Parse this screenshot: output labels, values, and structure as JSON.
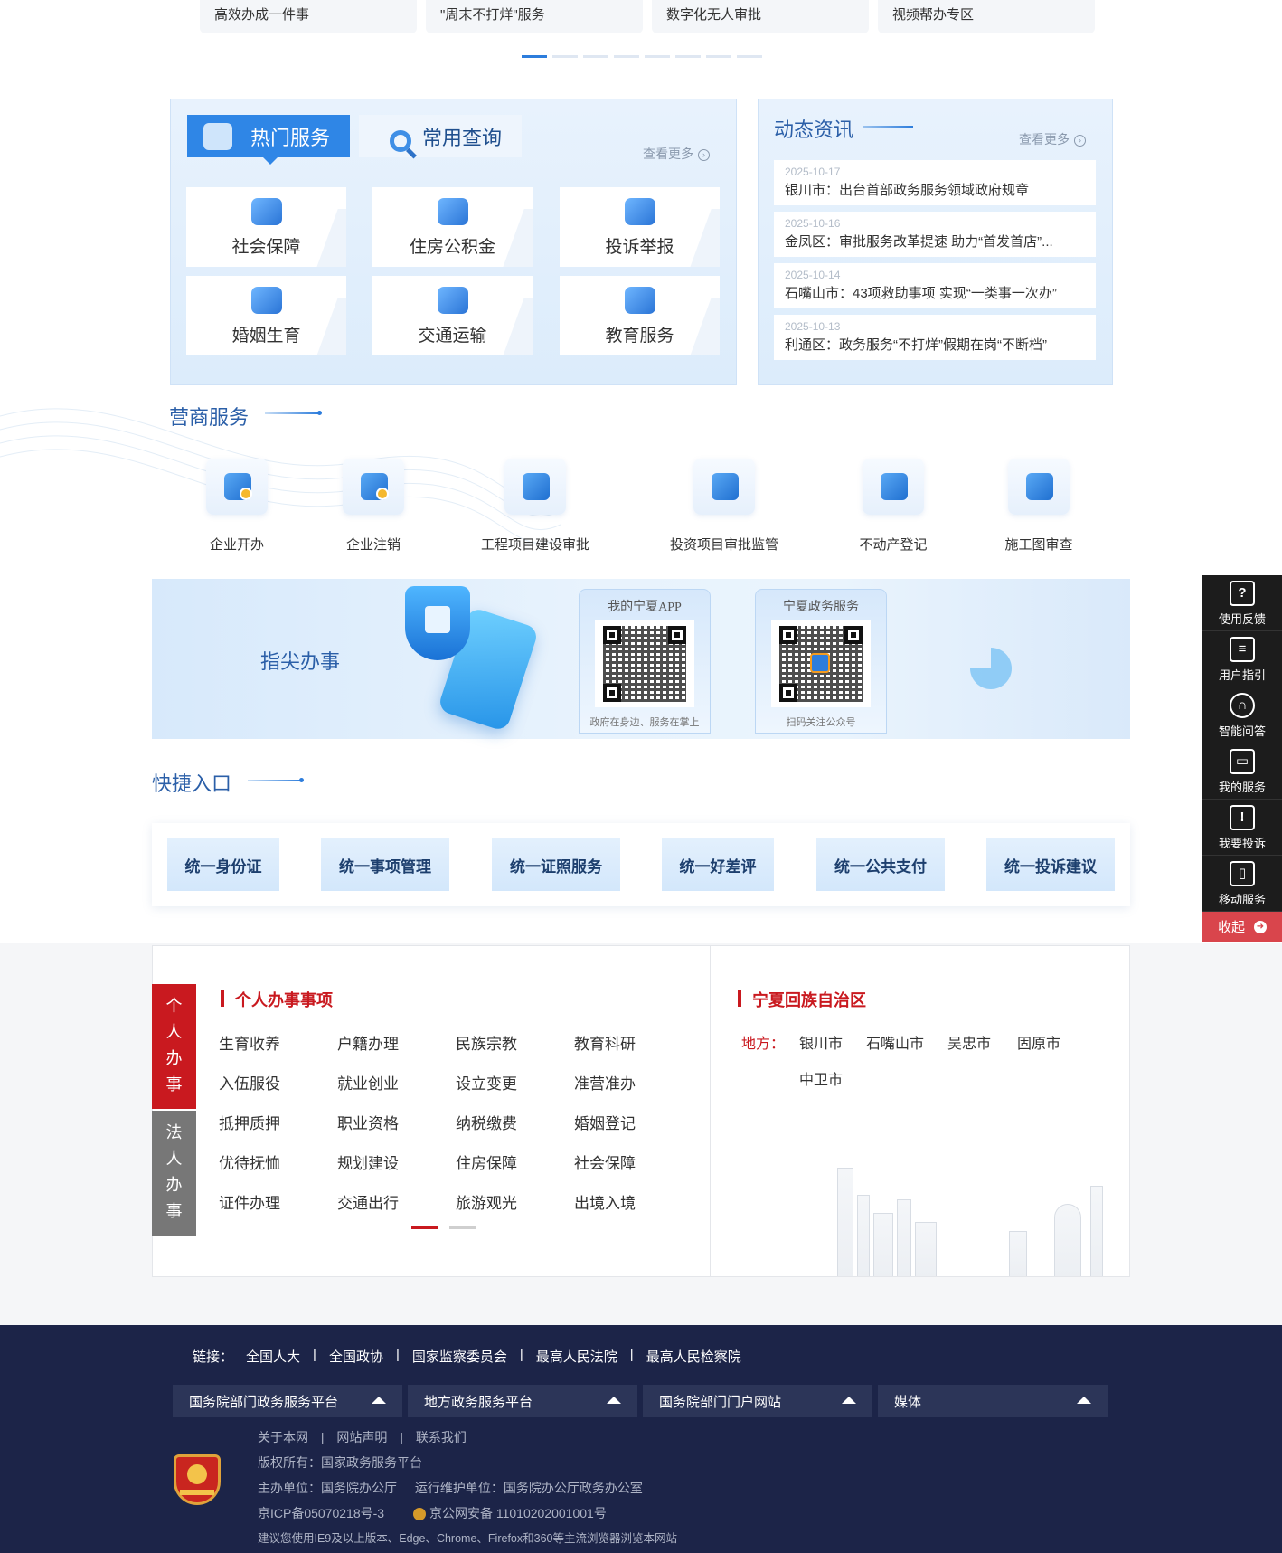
{
  "top_cards": [
    "高效办成一件事",
    "\"周末不打烊\"服务",
    "数字化无人审批",
    "视频帮办专区"
  ],
  "hot": {
    "tab_active": "热门服务",
    "tab_other": "常用查询",
    "more": "查看更多",
    "services": [
      "社会保障",
      "住房公积金",
      "投诉举报",
      "婚姻生育",
      "交通运输",
      "教育服务"
    ]
  },
  "news": {
    "title": "动态资讯",
    "more": "查看更多",
    "items": [
      {
        "date": "2025-10-17",
        "text": "银川市：出台首部政务服务领域政府规章"
      },
      {
        "date": "2025-10-16",
        "text": "金凤区：审批服务改革提速 助力“首发首店”..."
      },
      {
        "date": "2025-10-14",
        "text": "石嘴山市：43项救助事项 实现“一类事一次办”"
      },
      {
        "date": "2025-10-13",
        "text": "利通区：政务服务“不打烊”假期在岗“不断档”"
      }
    ]
  },
  "biz": {
    "title": "营商服务",
    "items": [
      "企业开办",
      "企业注销",
      "工程项目建设审批",
      "投资项目审批监管",
      "不动产登记",
      "施工图审查"
    ]
  },
  "fingertip": {
    "title": "指尖办事",
    "app_title": "我的宁夏APP",
    "app_caption": "政府在身边、服务在掌上",
    "gov_title": "宁夏政务服务",
    "gov_caption": "扫码关注公众号"
  },
  "quick": {
    "title": "快捷入口",
    "items": [
      "统一身份证",
      "统一事项管理",
      "统一证照服务",
      "统一好差评",
      "统一公共支付",
      "统一投诉建议"
    ]
  },
  "matters": {
    "tab_personal": [
      "个",
      "人",
      "办",
      "事"
    ],
    "tab_legal": [
      "法",
      "人",
      "办",
      "事"
    ],
    "heading": "个人办事事项",
    "items": [
      "生育收养",
      "户籍办理",
      "民族宗教",
      "教育科研",
      "入伍服役",
      "就业创业",
      "设立变更",
      "准营准办",
      "抵押质押",
      "职业资格",
      "纳税缴费",
      "婚姻登记",
      "优待抚恤",
      "规划建设",
      "住房保障",
      "社会保障",
      "证件办理",
      "交通出行",
      "旅游观光",
      "出境入境"
    ]
  },
  "region": {
    "heading": "宁夏回族自治区",
    "label": "地方：",
    "places": [
      "银川市",
      "石嘴山市",
      "吴忠市",
      "固原市",
      "中卫市"
    ]
  },
  "footer": {
    "links_label": "链接：",
    "links": [
      "全国人大",
      "全国政协",
      "国家监察委员会",
      "最高人民法院",
      "最高人民检察院"
    ],
    "separator": "|",
    "dropdowns": [
      "国务院部门政务服务平台",
      "地方政务服务平台",
      "国务院部门门户网站",
      "媒体"
    ],
    "about": [
      "关于本网",
      "网站声明",
      "联系我们"
    ],
    "copyright": "版权所有：国家政务服务平台",
    "sponsor": "主办单位：国务院办公厅",
    "operator": "运行维护单位：国务院办公厅政务办公室",
    "icp": "京ICP备05070218号-3",
    "police": "京公网安备 11010202001001号",
    "browser": "建议您使用IE9及以上版本、Edge、Chrome、Firefox和360等主流浏览器浏览本网站"
  },
  "side": {
    "items": [
      {
        "label": "使用反馈",
        "icon": "feedback-icon"
      },
      {
        "label": "用户指引",
        "icon": "guide-icon"
      },
      {
        "label": "智能问答",
        "icon": "headset-icon"
      },
      {
        "label": "我的服务",
        "icon": "monitor-icon"
      },
      {
        "label": "我要投诉",
        "icon": "complaint-icon"
      },
      {
        "label": "移动服务",
        "icon": "mobile-icon"
      }
    ],
    "collapse": "收起"
  }
}
